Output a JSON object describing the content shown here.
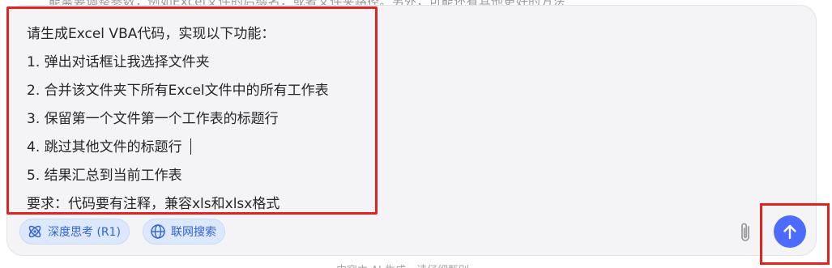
{
  "top_partial_text": "能需要调整参数，例如Excel文件的后缀名，或者文件夹路径。另外，可能还有其他更好的方法",
  "prompt": {
    "lines": [
      "请生成Excel VBA代码，实现以下功能：",
      "1. 弹出对话框让我选择文件夹",
      "2. 合并该文件夹下所有Excel文件中的所有工作表",
      "3. 保留第一个文件第一个工作表的标题行",
      "4. 跳过其他文件的标题行",
      "5. 结果汇总到当前工作表",
      "要求：代码要有注释，兼容xls和xlsx格式"
    ]
  },
  "toolbar": {
    "deep_think_label": "深度思考 (R1)",
    "web_search_label": "联网搜索"
  },
  "footer_partial_text": "内容由 AI 生成，请仔细甄别",
  "icons": {
    "deep_think": "atom-icon",
    "web_search": "globe-icon",
    "attach": "paperclip-icon",
    "send": "arrow-up-icon"
  },
  "colors": {
    "accent": "#4d6bfe",
    "chip_bg": "#dbe8fd",
    "chip_text": "#3462d8",
    "annotation": "#e0231f",
    "input_bg": "#f4f4f7"
  }
}
